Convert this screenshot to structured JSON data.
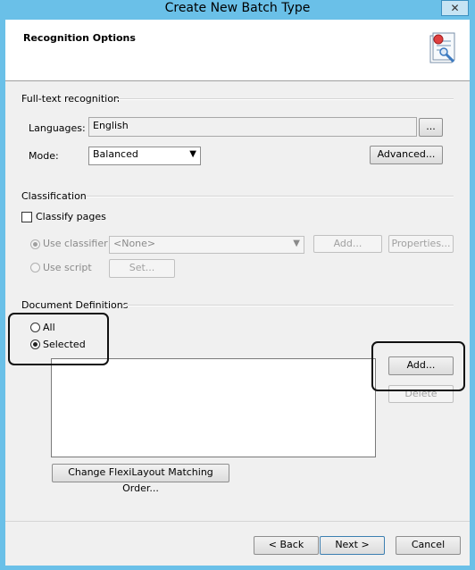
{
  "window": {
    "title": "Create New Batch Type",
    "close_glyph": "✕"
  },
  "header": {
    "title": "Recognition Options",
    "icon": "wizard-document-icon"
  },
  "full_text": {
    "group_label": "Full-text recognition",
    "languages_label": "Languages:",
    "languages_value": "English",
    "browse_button": "...",
    "mode_label": "Mode:",
    "mode_value": "Balanced",
    "advanced_button": "Advanced..."
  },
  "classification": {
    "group_label": "Classification",
    "classify_pages_label": "Classify pages",
    "classify_pages_checked": false,
    "use_classifier_label": "Use classifier",
    "classifier_value": "<None>",
    "add_button": "Add...",
    "properties_button": "Properties...",
    "use_script_label": "Use script",
    "set_button": "Set..."
  },
  "document_definitions": {
    "group_label": "Document Definitions",
    "all_label": "All",
    "selected_label": "Selected",
    "selected_option": "Selected",
    "add_button": "Add...",
    "delete_button": "Delete",
    "change_order_button": "Change FlexiLayout Matching Order..."
  },
  "footer": {
    "back_button": "< Back",
    "next_button": "Next >",
    "cancel_button": "Cancel"
  },
  "colors": {
    "title_bar": "#6ac0e8",
    "highlight": "#111111"
  }
}
